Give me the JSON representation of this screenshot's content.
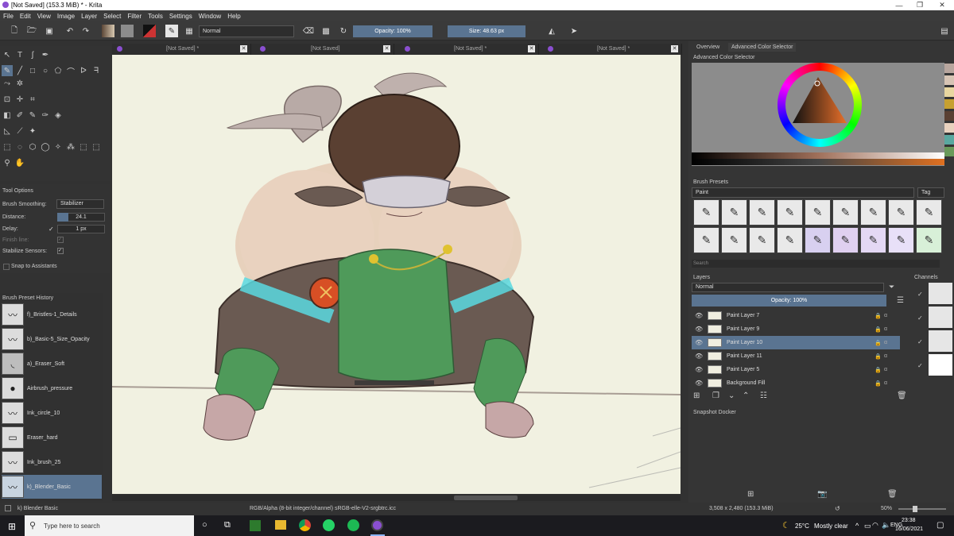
{
  "window": {
    "title": "[Not Saved]  (153.3 MiB)  * - Krita"
  },
  "menu": [
    "File",
    "Edit",
    "View",
    "Image",
    "Layer",
    "Select",
    "Filter",
    "Tools",
    "Settings",
    "Window",
    "Help"
  ],
  "toolbar": {
    "blend_mode": "Normal",
    "opacity": "Opacity: 100%",
    "size": "Size: 48.63 px"
  },
  "tabs": [
    "[Not Saved]  *",
    "[Not Saved]",
    "[Not Saved]  *",
    "[Not Saved]  *"
  ],
  "tool_options": {
    "title": "Tool Options",
    "brush_smoothing_label": "Brush Smoothing:",
    "brush_smoothing_value": "Stabilizer",
    "distance_label": "Distance:",
    "distance_value": "24.1",
    "delay_label": "Delay:",
    "delay_value": "1 px",
    "finish_line_label": "Finish line:",
    "stabilize_sensors_label": "Stabilize Sensors:",
    "snap_label": "Snap to Assistants"
  },
  "preset_history": {
    "title": "Brush Preset History",
    "items": [
      "f)_Bristles-1_Details",
      "b)_Basic-5_Size_Opacity",
      "a)_Eraser_Soft",
      "Airbrush_pressure",
      "Ink_circle_10",
      "Eraser_hard",
      "Ink_brush_25",
      "k)_Blender_Basic"
    ]
  },
  "right_panel": {
    "tab_overview": "Overview",
    "tab_color": "Advanced Color Selector",
    "color_selector_title": "Advanced Color Selector",
    "brush_presets_title": "Brush Presets",
    "brush_presets_filter": "Paint",
    "tag_label": "Tag",
    "search_placeholder": "Search",
    "layers_title": "Layers",
    "layers_blend": "Normal",
    "layers_opacity": "Opacity:  100%",
    "channels_title": "Channels",
    "snapshot_title": "Snapshot Docker"
  },
  "layers": [
    "Paint Layer 7",
    "Paint Layer 9",
    "Paint Layer 10",
    "Paint Layer 11",
    "Paint Layer 5",
    "Background Fill"
  ],
  "selected_layer": "Paint Layer 10",
  "status": {
    "brush": "k) Blender Basic",
    "color_info": "RGB/Alpha (8-bit integer/channel)  sRGB-elle-V2-srgbtrc.icc",
    "doc_size": "3,508 x 2,480 (153.3 MiB)",
    "zoom": "50%"
  },
  "taskbar": {
    "search_placeholder": "Type here to search",
    "weather_temp": "25°C",
    "weather_desc": "Mostly clear",
    "language": "ENG",
    "time": "23:38",
    "date": "16/06/2021"
  },
  "colors": {
    "accent": "#5a7491",
    "canvas": "#f1f1e1"
  }
}
